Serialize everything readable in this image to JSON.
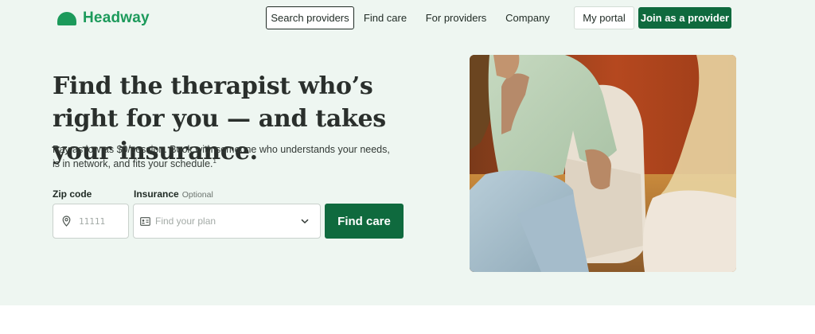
{
  "brand": {
    "name": "Headway"
  },
  "nav": {
    "search_providers": "Search providers",
    "find_care": "Find care",
    "for_providers": "For providers",
    "company": "Company",
    "my_portal": "My portal",
    "join": "Join as a provider"
  },
  "hero": {
    "headline": "Find the therapist who’s right for you — and takes your insurance.",
    "subtext": "Pay as low as $0/session. Book with someone who understands your needs, is in network, and fits your schedule.",
    "footnote": "1"
  },
  "form": {
    "zip_label": "Zip code",
    "zip_placeholder": "11111",
    "insurance_label": "Insurance",
    "insurance_optional": "Optional",
    "insurance_placeholder": "Find your plan",
    "submit_label": "Find care"
  },
  "colors": {
    "brand_green": "#1c9a5b",
    "button_green": "#0f6a3e",
    "hero_background": "#eef6f1"
  },
  "icons": {
    "zip": "location-pin-icon",
    "insurance": "id-card-icon",
    "dropdown": "chevron-down-icon"
  }
}
